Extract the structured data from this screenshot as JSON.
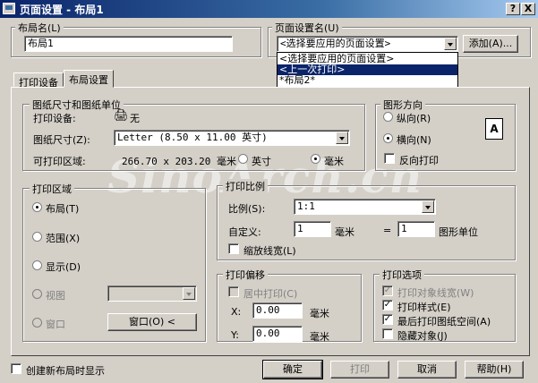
{
  "window": {
    "title": "页面设置 - 布局1",
    "help_glyph": "?",
    "close_glyph": "X"
  },
  "layout_name": {
    "label": "布局名(L)",
    "value": "布局1"
  },
  "page_setup_name": {
    "label": "页面设置名(U)",
    "selected": "<选择要应用的页面设置>",
    "add_button": "添加(A)...",
    "options": [
      "<选择要应用的页面设置>",
      "<上一次打印>",
      "*布局2*"
    ],
    "highlighted_index": 1
  },
  "tabs": [
    {
      "label": "打印设备"
    },
    {
      "label": "布局设置"
    }
  ],
  "active_tab": 1,
  "paper_size": {
    "group_label": "图纸尺寸和图纸单位",
    "plot_device_label": "打印设备:",
    "plot_device_value": "无",
    "paper_size_label": "图纸尺寸(Z):",
    "paper_size_value": "Letter (8.50 x 11.00 英寸)",
    "printable_area_label": "可打印区域:",
    "printable_area_value": "266.70 x 203.20 毫米",
    "units": [
      {
        "label": "英寸",
        "selected": false
      },
      {
        "label": "毫米",
        "selected": true
      }
    ]
  },
  "orientation": {
    "group_label": "图形方向",
    "options": [
      {
        "label": "纵向(R)",
        "selected": false
      },
      {
        "label": "横向(N)",
        "selected": true
      }
    ],
    "reverse_label": "反向打印",
    "reverse_checked": false,
    "icon_letter": "A"
  },
  "plot_area": {
    "group_label": "打印区域",
    "options": [
      {
        "label": "布局(T)",
        "selected": true,
        "enabled": true
      },
      {
        "label": "范围(X)",
        "selected": false,
        "enabled": true
      },
      {
        "label": "显示(D)",
        "selected": false,
        "enabled": true
      },
      {
        "label": "视图",
        "selected": false,
        "enabled": false
      },
      {
        "label": "窗口",
        "selected": false,
        "enabled": false
      }
    ],
    "window_button": "窗口(O) <"
  },
  "plot_scale": {
    "group_label": "打印比例",
    "scale_label": "比例(S):",
    "scale_value": "1:1",
    "custom_label": "自定义:",
    "custom_left": "1",
    "unit_left": "毫米",
    "equals": "=",
    "custom_right": "1",
    "unit_right": "图形单位",
    "scale_lineweight_label": "缩放线宽(L)",
    "scale_lineweight_checked": false
  },
  "plot_offset": {
    "group_label": "打印偏移",
    "center_label": "居中打印(C)",
    "center_checked": false,
    "x_label": "X:",
    "x_value": "0.00",
    "x_unit": "毫米",
    "y_label": "Y:",
    "y_value": "0.00",
    "y_unit": "毫米"
  },
  "plot_options": {
    "group_label": "打印选项",
    "items": [
      {
        "label": "打印对象线宽(W)",
        "checked": true,
        "enabled": false
      },
      {
        "label": "打印样式(E)",
        "checked": true,
        "enabled": true
      },
      {
        "label": "最后打印图纸空间(A)",
        "checked": true,
        "enabled": true
      },
      {
        "label": "隐藏对象(J)",
        "checked": false,
        "enabled": true
      }
    ]
  },
  "footer": {
    "create_new_layout_label": "创建新布局时显示",
    "create_new_layout_checked": false,
    "buttons": {
      "ok": "确定",
      "plot": "打印",
      "cancel": "取消",
      "help": "帮助(H)"
    }
  },
  "watermark": "SinoArch.cn"
}
